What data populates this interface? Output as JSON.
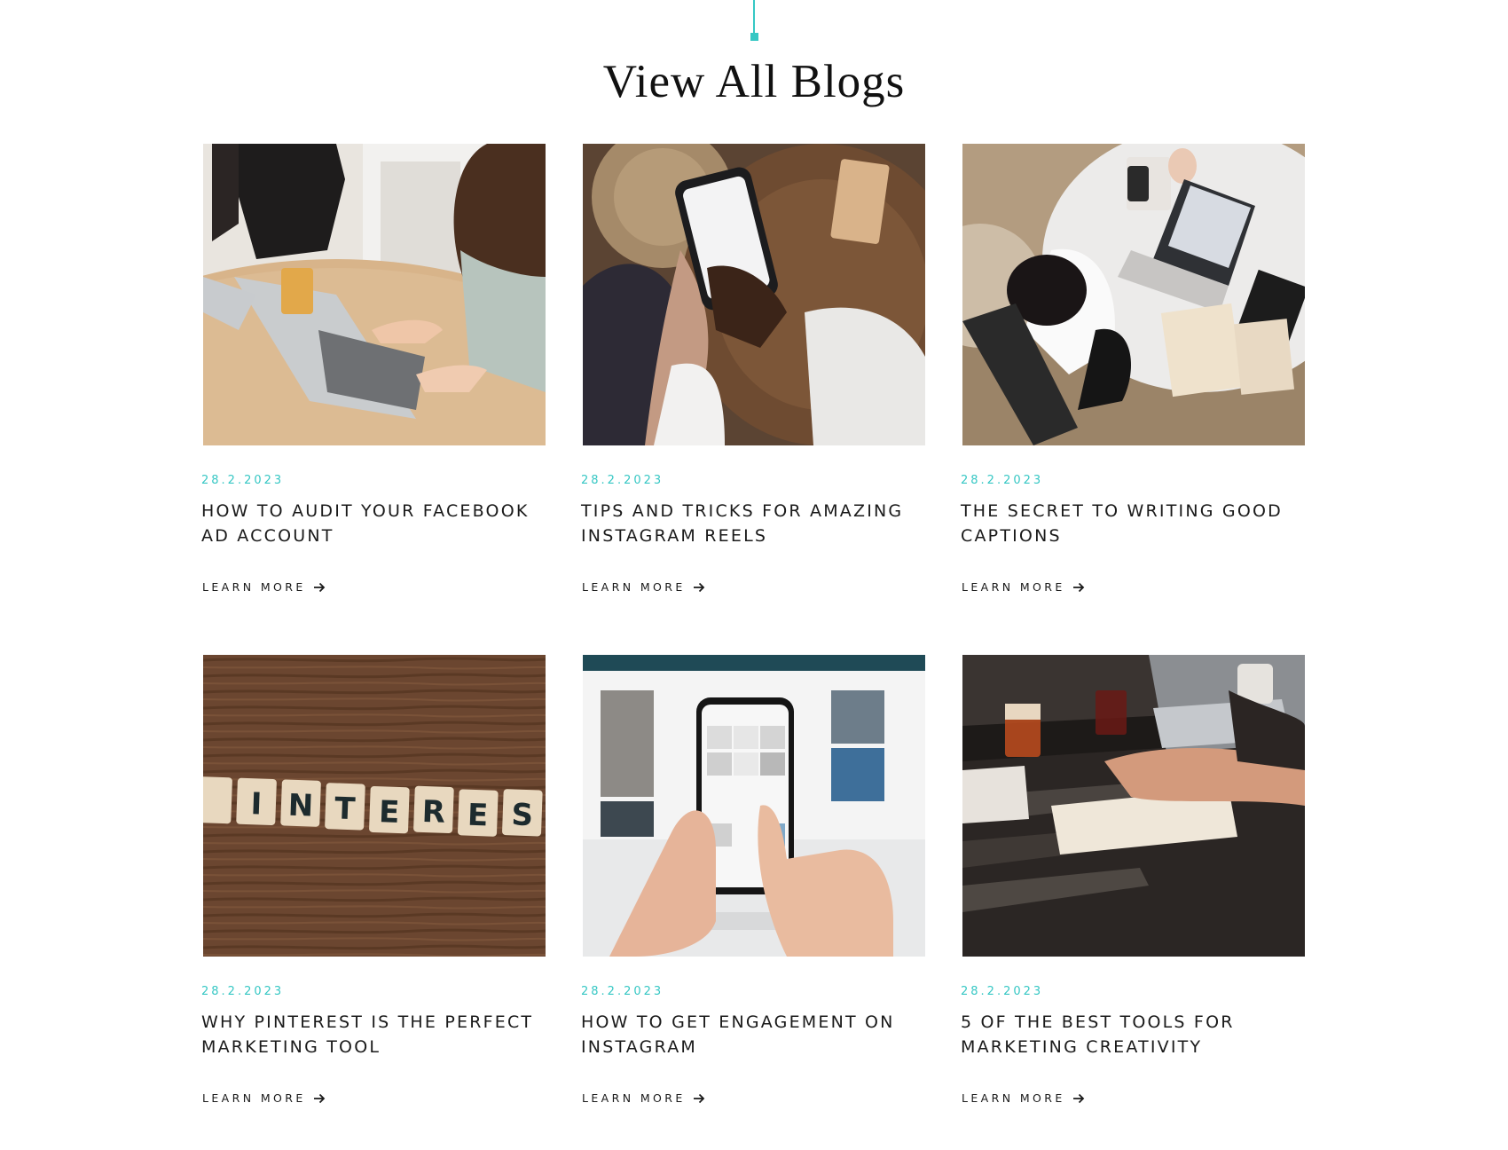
{
  "section": {
    "title": "View All Blogs",
    "accent_color": "#36c7c4"
  },
  "posts": [
    {
      "image": "women-working-on-laptop-photo",
      "date": "28.2.2023",
      "title": "How to Audit Your Facebook Ad Account",
      "cta": "Learn More",
      "cta_icon": "arrow-right-icon"
    },
    {
      "image": "hands-holding-smartphone-photo",
      "date": "28.2.2023",
      "title": "Tips and Tricks for Amazing Instagram Reels",
      "cta": "Learn More",
      "cta_icon": "arrow-right-icon"
    },
    {
      "image": "woman-typing-on-laptop-overhead-photo",
      "date": "28.2.2023",
      "title": "The Secret to Writing Good Captions",
      "cta": "Learn More",
      "cta_icon": "arrow-right-icon"
    },
    {
      "image": "scrabble-tiles-pinterest-photo",
      "image_text": "INTERES",
      "date": "28.2.2023",
      "title": "Why Pinterest is the Perfect Marketing Tool",
      "cta": "Learn More",
      "cta_icon": "arrow-right-icon"
    },
    {
      "image": "phone-instagram-feed-photo",
      "date": "28.2.2023",
      "title": "How to Get Engagement on Instagram",
      "cta": "Learn More",
      "cta_icon": "arrow-right-icon"
    },
    {
      "image": "desk-writing-notes-photo",
      "date": "28.2.2023",
      "title": "5 of the Best Tools for Marketing Creativity",
      "cta": "Learn More",
      "cta_icon": "arrow-right-icon"
    }
  ]
}
